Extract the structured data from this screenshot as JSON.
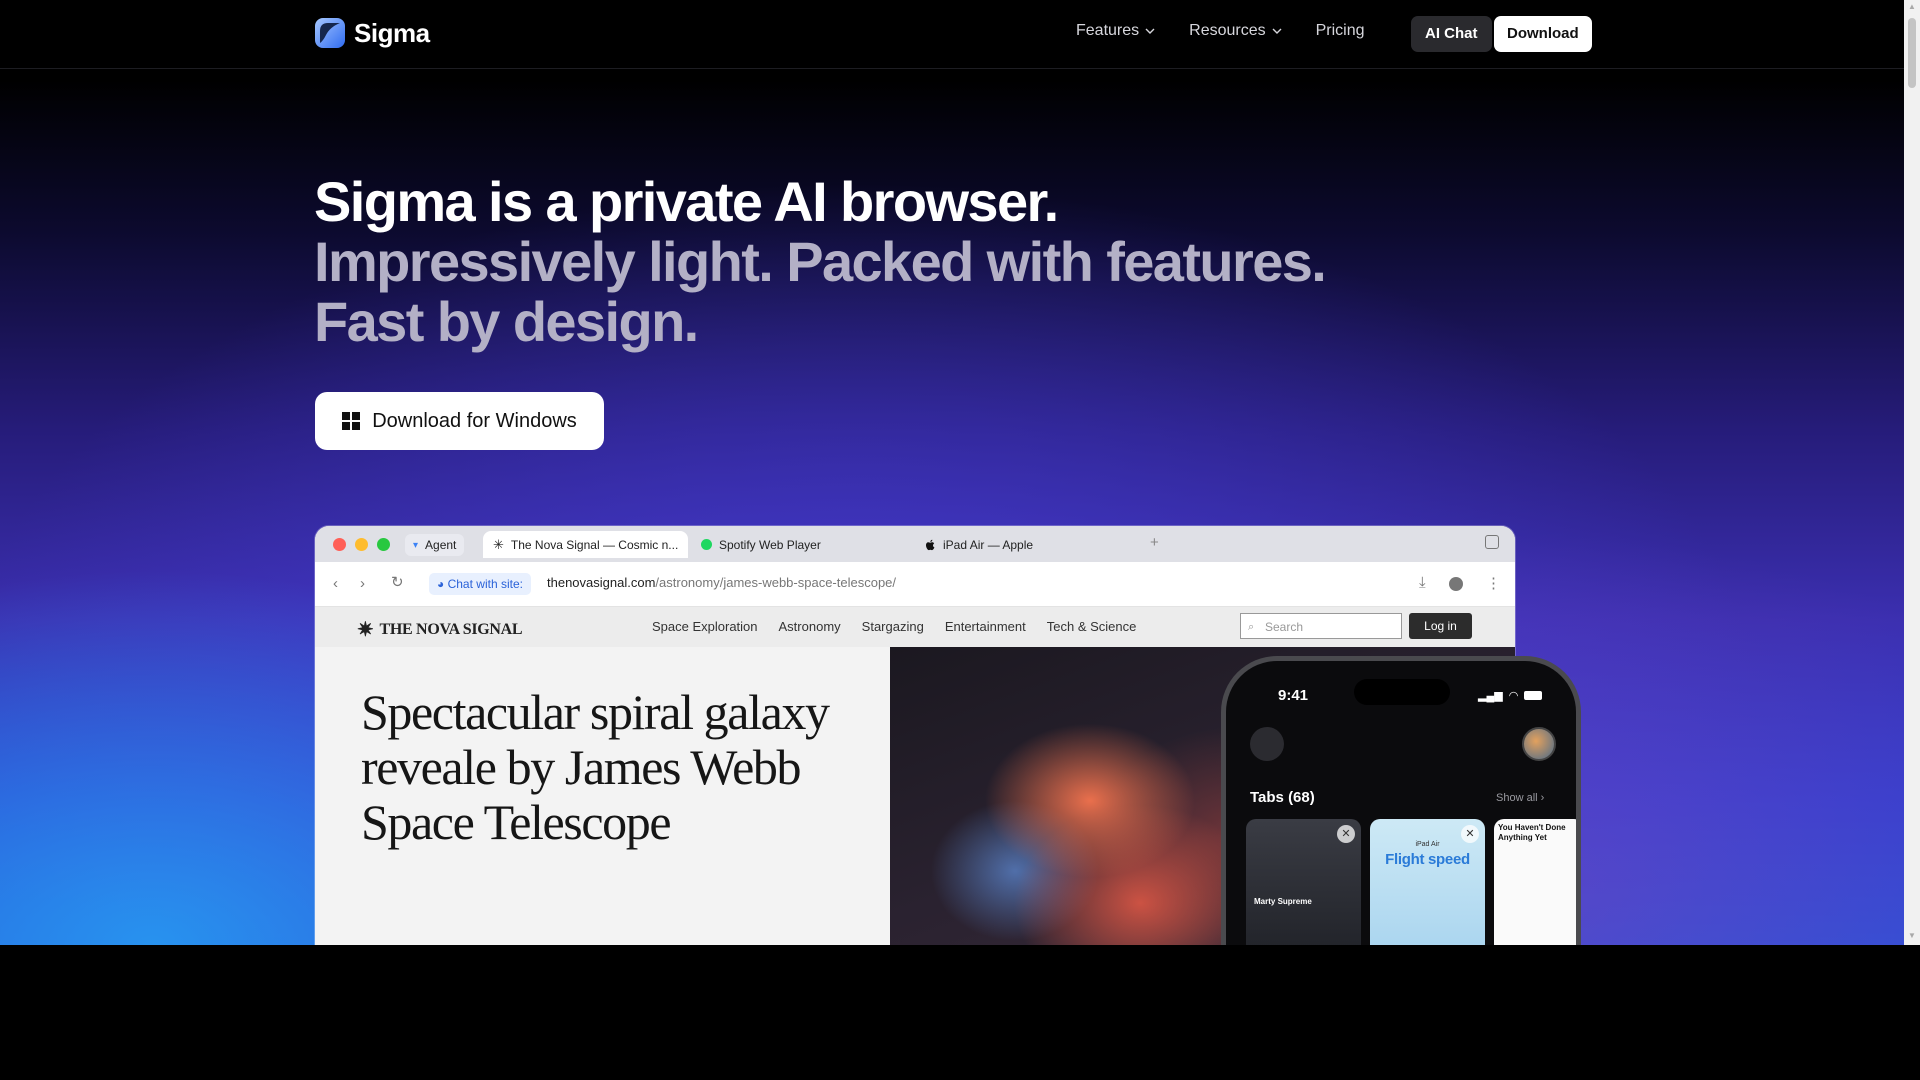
{
  "brand": {
    "name": "Sigma",
    "accent": "#3b82f6"
  },
  "nav": {
    "links": [
      {
        "label": "Features",
        "has_dropdown": true
      },
      {
        "label": "Resources",
        "has_dropdown": true
      },
      {
        "label": "Pricing",
        "has_dropdown": false
      }
    ],
    "ai_chat": "AI Chat",
    "download": "Download"
  },
  "hero": {
    "line1": "Sigma is a private AI browser.",
    "line2": "Impressively light. Packed with features.",
    "line3": "Fast by design.",
    "cta": "Download for Windows"
  },
  "mockup": {
    "tabs": [
      {
        "label": "Agent",
        "icon": "agent-icon"
      },
      {
        "label": "The Nova Signal — Cosmic n...",
        "icon": "nova-icon",
        "active": true
      },
      {
        "label": "Spotify Web Player",
        "icon": "spotify-icon"
      },
      {
        "label": "iPad Air — Apple",
        "icon": "apple-icon"
      }
    ],
    "chat_with_site": "Chat with site:",
    "url_domain": "thenovasignal.com",
    "url_path": "/astronomy/james-webb-space-telescope/",
    "site": {
      "logo": "THE NOVA SIGNAL",
      "nav": [
        "Space Exploration",
        "Astronomy",
        "Stargazing",
        "Entertainment",
        "Tech & Science"
      ],
      "search_placeholder": "Search",
      "login": "Log in",
      "headline": "Spectacular spiral galaxy reveale by James Webb Space Telescope"
    }
  },
  "phone": {
    "time": "9:41",
    "tabs_title": "Tabs (68)",
    "show_all": "Show all",
    "cards": [
      {
        "title": "Marty Supreme"
      },
      {
        "small": "iPad Air",
        "title": "Flight speed"
      },
      {
        "title": "You Haven't Done Anything Yet"
      }
    ]
  }
}
